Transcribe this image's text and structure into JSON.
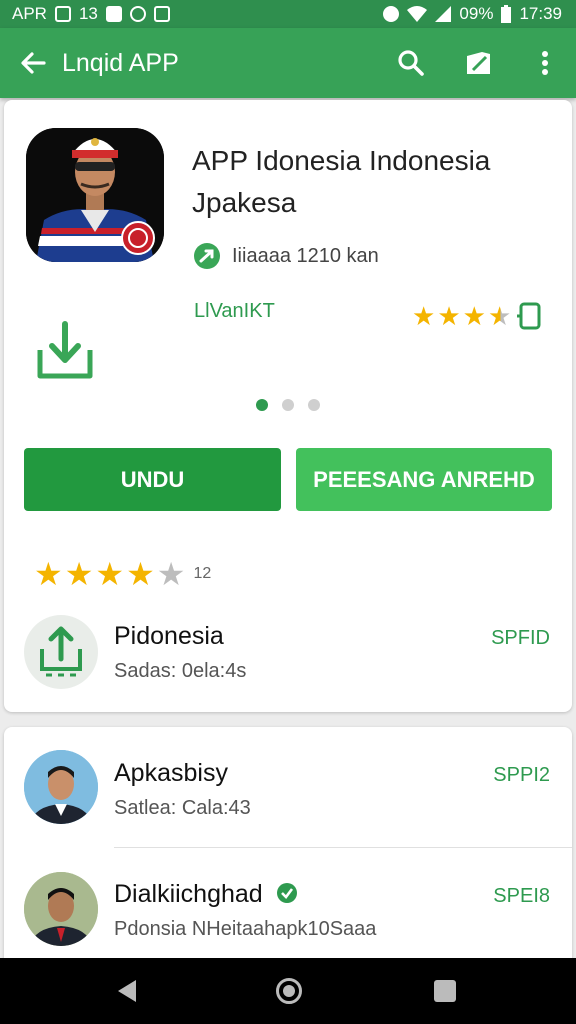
{
  "status_bar": {
    "carrier": "APR",
    "left_text": "13",
    "battery_pct": "09%",
    "time": "17:39"
  },
  "app_bar": {
    "title": "Lnqid APP",
    "icons": [
      "back-arrow-icon",
      "search-icon",
      "edit-icon",
      "more-vert-icon"
    ]
  },
  "app": {
    "title": "APP Idonesia Indonesia Jpakesa",
    "meta": "Iiiaaaa 1210 kan",
    "developer": "LlVanIKT",
    "rating_stars": 3.5
  },
  "pager": {
    "count": 3,
    "active": 0
  },
  "buttons": {
    "install": "UNDU",
    "open": "PEEESANG ANREHD"
  },
  "review": {
    "stars": 4,
    "count": "12"
  },
  "featured_item": {
    "title": "Pidonesia",
    "subtitle": "Sadas: 0ela:4s",
    "tag": "SPFID"
  },
  "list": [
    {
      "title": "Apkasbisy",
      "subtitle": "Satlea: Cala:43",
      "tag": "SPPI2"
    },
    {
      "title": "Dialkiichghad",
      "subtitle": "Pdonsia NHeitaahapk10Saaa",
      "tag": "SPEI8"
    }
  ],
  "colors": {
    "primary": "#37a257",
    "primary_dark": "#2f8f4e",
    "install_button": "#22993f",
    "open_button": "#43c15c",
    "star": "#f4b400"
  }
}
